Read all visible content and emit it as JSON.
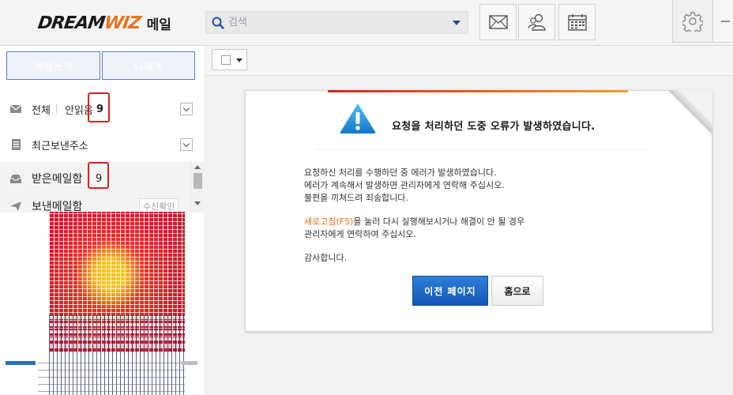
{
  "header": {
    "logo": {
      "brand_a": "DREAM",
      "brand_b": "WIZ",
      "suffix": "메일"
    },
    "search": {
      "placeholder": "검색",
      "value": ""
    },
    "icons": [
      "mail-icon",
      "contacts-icon",
      "calendar-icon",
      "gear-icon"
    ]
  },
  "sidebar": {
    "compose_label": "메일쓰기",
    "to_me_label": "나에게",
    "all": {
      "label": "전체",
      "unread_label": "안읽음",
      "unread_count": "9"
    },
    "recent": {
      "label": "최근보낸주소"
    },
    "folders": [
      {
        "label": "받은메일함",
        "count": "9"
      },
      {
        "label": "보낸메일함",
        "tag": "수신확인"
      }
    ]
  },
  "main": {
    "error": {
      "title": "요청을 처리하던 도중 오류가 발생하였습니다.",
      "line1": "요청하신 처리를 수행하던 중 에러가 발생하였습니다.",
      "line2": "에러가 계속해서 발생하면 관리자에게 연락해 주십시오.",
      "line3": "불편을 끼쳐드려 죄송합니다.",
      "refresh_link": "새로고침(F5)",
      "line4_rest": "을 눌러 다시 실행해보시거나 해결이 안 될 경우",
      "line5": "관리자에게 연락하여 주십시오.",
      "thanks": "감사합니다.",
      "prev_button": "이전 페이지",
      "home_button": "홈으로"
    }
  },
  "colors": {
    "primary_button": "#1e66c8",
    "link_orange": "#e36f1e",
    "highlight_red": "#e01b1b",
    "header_bg": "#f4f4f4"
  }
}
